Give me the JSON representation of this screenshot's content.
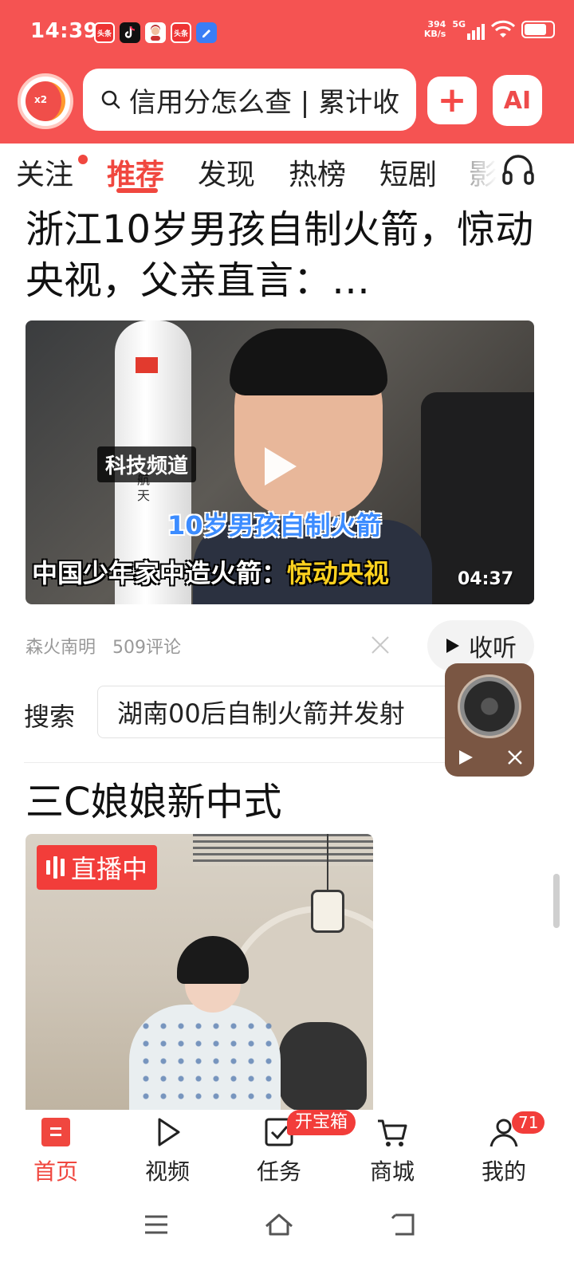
{
  "status_bar": {
    "time": "14:39",
    "net_speed_value": "394",
    "net_speed_unit": "KB/s",
    "signal_label": "5G",
    "battery_level": 0.8,
    "notification_icons": [
      "toutiao-red-icon",
      "tiktok-icon",
      "avatar-app-icon",
      "toutiao-red-icon",
      "blue-app-icon"
    ],
    "notif_1": "头条",
    "notif_4": "头条"
  },
  "header": {
    "avatar_badge": "x2",
    "search_placeholder": "信用分怎么查 | 累计收",
    "plus_label": "+",
    "ai_label": "AI"
  },
  "tabs": {
    "items": [
      {
        "label": "关注",
        "has_dot": true
      },
      {
        "label": "推荐",
        "active": true
      },
      {
        "label": "发现"
      },
      {
        "label": "热榜"
      },
      {
        "label": "短剧"
      },
      {
        "label": "影"
      }
    ]
  },
  "article1": {
    "title": "浙江10岁男孩自制火箭，惊动央视，父亲直言：…",
    "thumb_tag": "科技频道",
    "thumb_caption": "10岁男孩自制火箭",
    "thumb_bottom_white": "中国少年家中造火箭：",
    "thumb_bottom_yellow": "惊动央视",
    "rocket_text_1": "航",
    "rocket_text_2": "天",
    "duration": "04:37",
    "source": "森火南明",
    "comments": "509评论",
    "listen_label": "收听"
  },
  "search_row": {
    "label": "搜索",
    "suggestion": "湖南00后自制火箭并发射"
  },
  "article2": {
    "title": "三C娘娘新中式",
    "live_label": "直播中"
  },
  "bottom_nav": {
    "items": [
      {
        "label": "首页",
        "active": true
      },
      {
        "label": "视频"
      },
      {
        "label": "任务"
      },
      {
        "label": "商城"
      },
      {
        "label": "我的"
      }
    ],
    "task_badge": "开宝箱",
    "me_badge": "71"
  },
  "colors": {
    "brand_red": "#f55352",
    "active_tab": "#f0473f",
    "badge_red": "#f23d3a"
  }
}
